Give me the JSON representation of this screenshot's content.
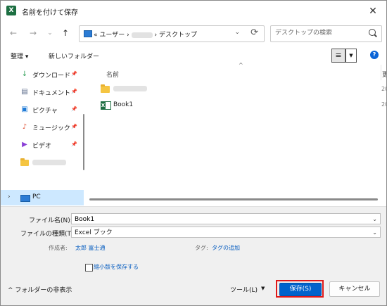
{
  "window": {
    "title": "名前を付けて保存",
    "app_icon": "X",
    "close": "✕"
  },
  "address": {
    "prefix": "«",
    "segments": [
      "ユーザー",
      "デスクトップ"
    ],
    "separator": "›",
    "refresh": "⟳",
    "dropdown": "⌄"
  },
  "search": {
    "placeholder": "デスクトップの検索"
  },
  "nav_buttons": {
    "back": "←",
    "forward": "→",
    "history": "⌄",
    "up": "↑"
  },
  "commandbar": {
    "organize": "整理 ▾",
    "new_folder": "新しいフォルダー",
    "view": "≡",
    "view_dropdown": "▼",
    "help": "?"
  },
  "sidebar": {
    "items": [
      {
        "label": "ダウンロード",
        "icon": "download-icon",
        "glyph": "↓",
        "color": "#2a9d53",
        "pinned": true
      },
      {
        "label": "ドキュメント",
        "icon": "document-icon",
        "glyph": "▤",
        "color": "#5a6b8a",
        "pinned": true
      },
      {
        "label": "ピクチャ",
        "icon": "pictures-icon",
        "glyph": "▣",
        "color": "#1e7ad6",
        "pinned": true
      },
      {
        "label": "ミュージック",
        "icon": "music-icon",
        "glyph": "♪",
        "color": "#e2573b",
        "pinned": true
      },
      {
        "label": "ビデオ",
        "icon": "video-icon",
        "glyph": "▶",
        "color": "#8a3fd6",
        "pinned": true
      },
      {
        "label": "",
        "icon": "folder-icon",
        "glyph": "",
        "color": "#f5c542",
        "pinned": false
      }
    ],
    "pin_glyph": "📌",
    "pc": {
      "label": "PC",
      "expander": "›"
    }
  },
  "file_list": {
    "columns": {
      "name": "名前",
      "date": "更",
      "sort": "^"
    },
    "rows": [
      {
        "name": "",
        "type": "folder",
        "date": "20"
      },
      {
        "name": "Book1",
        "type": "excel",
        "date": "20"
      }
    ]
  },
  "form": {
    "filename_label": "ファイル名(N):",
    "filename_value": "Book1",
    "filetype_label": "ファイルの種類(T):",
    "filetype_value": "Excel ブック",
    "author_label": "作成者:",
    "author_value": "太郎 富士通",
    "tags_label": "タグ:",
    "tags_value": "タグの追加",
    "thumbnail_label": "縮小版を保存する",
    "dropdown": "⌄"
  },
  "footer": {
    "hide_folders": "フォルダーの非表示",
    "hide_folders_icon": "^",
    "tools": "ツール(L)",
    "tools_dropdown": "▼",
    "save": "保存(S)",
    "cancel": "キャンセル"
  }
}
